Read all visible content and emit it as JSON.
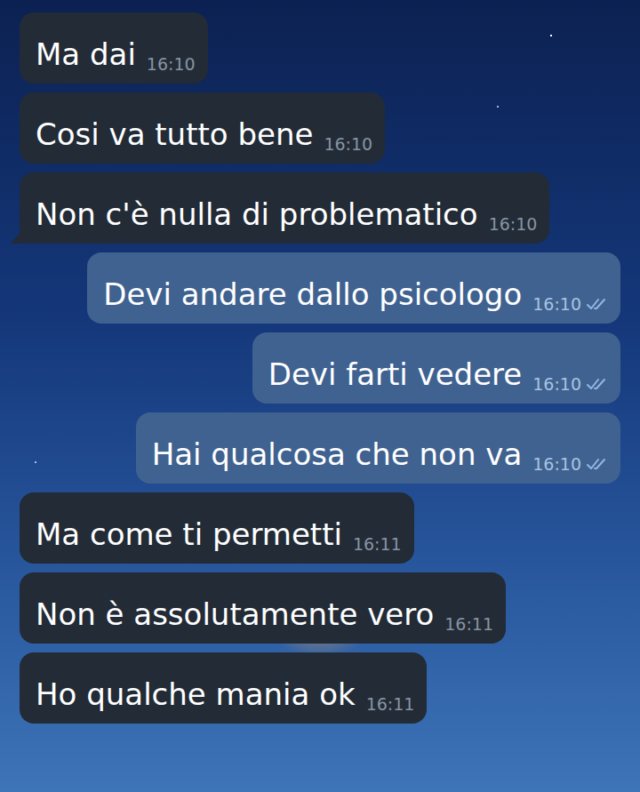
{
  "chat": {
    "messages": [
      {
        "text": "Ma dai",
        "time": "16:10",
        "kind": "incoming",
        "read": false,
        "tail": false
      },
      {
        "text": "Cosi va tutto bene",
        "time": "16:10",
        "kind": "incoming",
        "read": false,
        "tail": false
      },
      {
        "text": "Non c'è nulla di problematico",
        "time": "16:10",
        "kind": "incoming",
        "read": false,
        "tail": true
      },
      {
        "text": "Devi andare dallo psicologo",
        "time": "16:10",
        "kind": "outgoing",
        "read": true,
        "tail": false
      },
      {
        "text": "Devi farti vedere",
        "time": "16:10",
        "kind": "outgoing",
        "read": true,
        "tail": false
      },
      {
        "text": "Hai qualcosa che non va",
        "time": "16:10",
        "kind": "outgoing",
        "read": true,
        "tail": false
      },
      {
        "text": "Ma come ti permetti",
        "time": "16:11",
        "kind": "incoming",
        "read": false,
        "tail": false
      },
      {
        "text": "Non è assolutamente vero",
        "time": "16:11",
        "kind": "incoming",
        "read": false,
        "tail": false
      },
      {
        "text": "Ho qualche mania ok",
        "time": "16:11",
        "kind": "incoming",
        "read": false,
        "tail": false
      }
    ]
  }
}
